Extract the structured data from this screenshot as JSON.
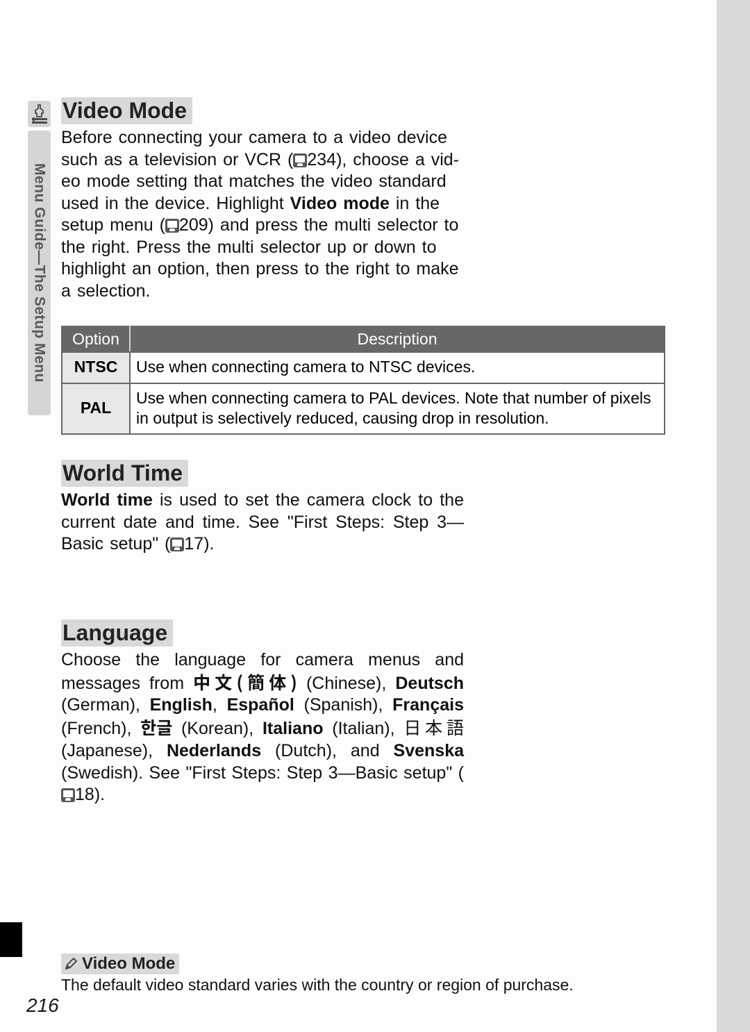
{
  "sidebar": {
    "label": "Menu Guide—The Setup Menu"
  },
  "sections": {
    "video_mode": {
      "heading": "Video Mode",
      "para_pre": "Before connecting your camera to a video device such as a television or VCR (",
      "ref1": "234",
      "para_mid1": "), choose a vid­eo mode setting that matches the video standard used in the device.  Highlight ",
      "bold1": "Video mode",
      "para_mid2": " in the setup menu (",
      "ref2": "209",
      "para_tail": ") and press the multi selector to the right.  Press the multi selector up or down to highlight an option, then press to the right to make a selection."
    },
    "table": {
      "head_option": "Option",
      "head_description": "Description",
      "rows": [
        {
          "option": "NTSC",
          "description": "Use when connecting camera to NTSC devices."
        },
        {
          "option": "PAL",
          "description": "Use when connecting camera to PAL devices.  Note that number of pixels in output is selectively reduced, causing drop in resolution."
        }
      ]
    },
    "world_time": {
      "heading": "World Time",
      "bold_lead": "World time",
      "para_mid": " is used to set the camera clock to the current date and time.  See \"First Steps: Step 3—Basic setup\" (",
      "ref": "17",
      "para_tail": ")."
    },
    "language": {
      "heading": "Language",
      "text_pre": "Choose the language for camera menus and messages from ",
      "zh_bold": "中文(簡体)",
      "zh_paren": " (Chinese), ",
      "de_bold": "Deutsch",
      "de_paren": " (German), ",
      "en_bold": "English",
      "sep1": ", ",
      "es_bold": "Español",
      "es_paren": " (Spanish), ",
      "fr_bold": "Français",
      "fr_paren": " (French), ",
      "ko_bold": "한글",
      "ko_paren": " (Korean), ",
      "it_bold": "Italiano",
      "it_paren": " (Italian), ",
      "ja": "日本語",
      "ja_paren": " (Japanese), ",
      "nl_bold": "Nederlands",
      "nl_paren": " (Dutch), and ",
      "sv_bold": "Svenska",
      "sv_paren": " (Swedish).  See \"First Steps: Step 3—Basic setup\" (",
      "ref": "18",
      "tail": ")."
    }
  },
  "note": {
    "title": "Video Mode",
    "body": "The default video standard varies with the country or region of purchase."
  },
  "page_number": "216"
}
